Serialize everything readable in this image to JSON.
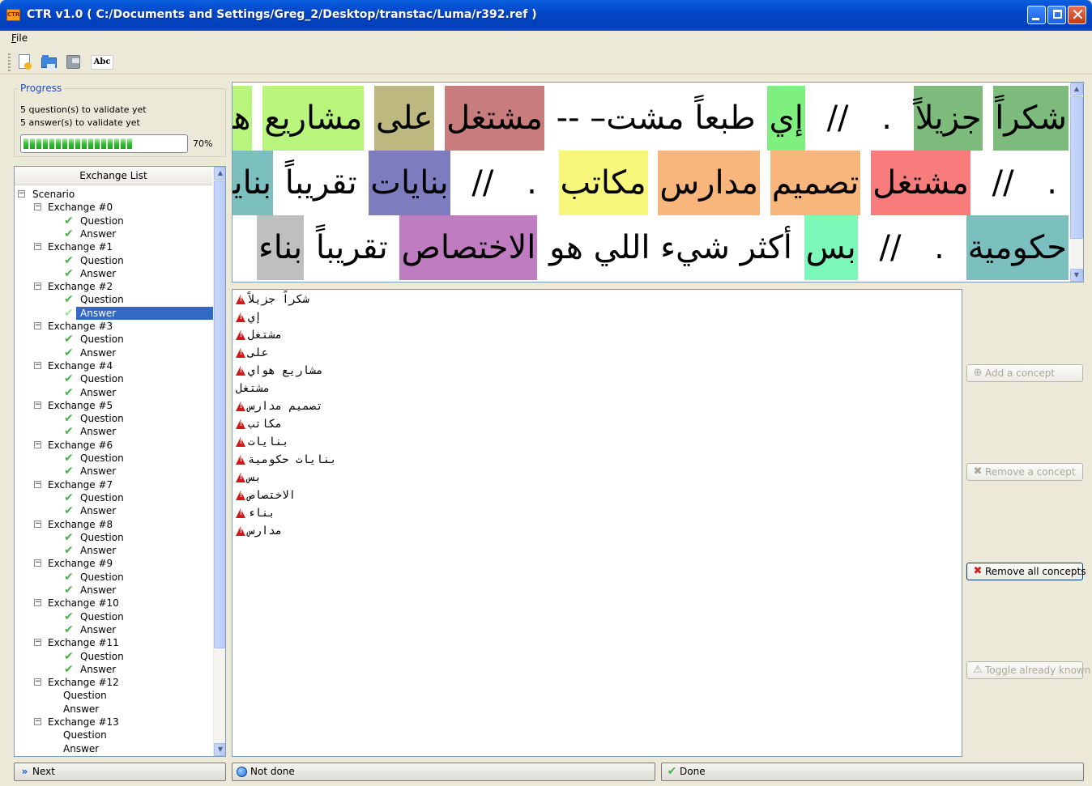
{
  "window": {
    "title": "CTR v1.0 ( C:/Documents and Settings/Greg_2/Desktop/transtac/Luma/r392.ref )",
    "icon_text": "CTR"
  },
  "menu": {
    "file": "File"
  },
  "toolbar": {
    "icons": [
      "new-document-icon",
      "open-folder-icon",
      "save-disk-icon",
      "spellcheck-abc-icon"
    ],
    "abc_label": "Abc"
  },
  "progress": {
    "title": "Progress",
    "line1": "5 question(s) to validate yet",
    "line2": "5 answer(s) to validate yet",
    "percent_label": "70%",
    "percent": 70
  },
  "exchange_list": {
    "header": "Exchange List",
    "root": "Scenario",
    "exchanges": [
      {
        "label": "Exchange #0",
        "question": "Question",
        "answer": "Answer",
        "validated": true
      },
      {
        "label": "Exchange #1",
        "question": "Question",
        "answer": "Answer",
        "validated": true
      },
      {
        "label": "Exchange #2",
        "question": "Question",
        "answer": "Answer",
        "validated": true,
        "selected": "answer"
      },
      {
        "label": "Exchange #3",
        "question": "Question",
        "answer": "Answer",
        "validated": true
      },
      {
        "label": "Exchange #4",
        "question": "Question",
        "answer": "Answer",
        "validated": true
      },
      {
        "label": "Exchange #5",
        "question": "Question",
        "answer": "Answer",
        "validated": true
      },
      {
        "label": "Exchange #6",
        "question": "Question",
        "answer": "Answer",
        "validated": true
      },
      {
        "label": "Exchange #7",
        "question": "Question",
        "answer": "Answer",
        "validated": true
      },
      {
        "label": "Exchange #8",
        "question": "Question",
        "answer": "Answer",
        "validated": true
      },
      {
        "label": "Exchange #9",
        "question": "Question",
        "answer": "Answer",
        "validated": true
      },
      {
        "label": "Exchange #10",
        "question": "Question",
        "answer": "Answer",
        "validated": true
      },
      {
        "label": "Exchange #11",
        "question": "Question",
        "answer": "Answer",
        "validated": true
      },
      {
        "label": "Exchange #12",
        "question": "Question",
        "answer": "Answer",
        "validated": false
      },
      {
        "label": "Exchange #13",
        "question": "Question",
        "answer": "Answer",
        "validated": false
      }
    ]
  },
  "arabic_text": {
    "lines": [
      [
        {
          "t": "شكراً",
          "c": "#7cbb7c"
        },
        {
          "t": "جزيلاً",
          "c": "#7cbb7c"
        },
        {
          "t": ".",
          "c": null
        },
        {
          "t": "//",
          "c": null
        },
        {
          "t": "إي",
          "c": "#7ff07f"
        },
        {
          "t": "طبعاً مشت– --",
          "c": null
        },
        {
          "t": "مشتغل",
          "c": "#c87c7c"
        },
        {
          "t": "على",
          "c": "#bdb880"
        },
        {
          "t": "مشاريع",
          "c": "#b9f57d"
        },
        {
          "t": "هواي",
          "c": "#b9f57d"
        }
      ],
      [
        {
          "t": ".",
          "c": null
        },
        {
          "t": "//",
          "c": null
        },
        {
          "t": "مشتغل",
          "c": "#f87c7c"
        },
        {
          "t": "تصميم",
          "c": "#f9b67c"
        },
        {
          "t": "مدارس",
          "c": "#f9b67c"
        },
        {
          "t": "مكاتب",
          "c": "#f7f77c"
        },
        {
          "t": ".",
          "c": null
        },
        {
          "t": "//",
          "c": null
        },
        {
          "t": "بنايات",
          "c": "#7c7cbe"
        },
        {
          "t": "تقريباً",
          "c": null
        },
        {
          "t": "بنايات",
          "c": "#7cbfbf"
        }
      ],
      [
        {
          "t": "حكومية",
          "c": "#7cbfbf"
        },
        {
          "t": ".",
          "c": null
        },
        {
          "t": "//",
          "c": null
        },
        {
          "t": "بس",
          "c": "#7cf8b8"
        },
        {
          "t": "أكثر شيء اللي هو",
          "c": null
        },
        {
          "t": "الاختصاص",
          "c": "#c07cc0"
        },
        {
          "t": "تقريباً",
          "c": null
        },
        {
          "t": "بناء",
          "c": "#bfbfbf"
        }
      ]
    ]
  },
  "concepts": [
    {
      "text": "شكراً جزيلاً",
      "warning": true
    },
    {
      "text": "إي",
      "warning": true
    },
    {
      "text": "مشتغل",
      "warning": true
    },
    {
      "text": "على",
      "warning": true
    },
    {
      "text": "مشاريع هواي",
      "warning": true
    },
    {
      "text": "مشتغل",
      "warning": false
    },
    {
      "text": "تصميم مدارس",
      "warning": true
    },
    {
      "text": "مكاتب",
      "warning": true
    },
    {
      "text": "بنايات",
      "warning": true
    },
    {
      "text": "بنايات حكومية",
      "warning": true
    },
    {
      "text": "بس",
      "warning": true
    },
    {
      "text": "الاختصاص",
      "warning": true
    },
    {
      "text": "بناء",
      "warning": true
    },
    {
      "text": "مدارس",
      "warning": true
    }
  ],
  "actions": {
    "add": "Add a concept",
    "remove": "Remove a concept",
    "remove_all": "Remove all concepts",
    "toggle": "Toggle already known"
  },
  "bottom": {
    "next": "Next",
    "not_done": "Not done",
    "done": "Done"
  }
}
